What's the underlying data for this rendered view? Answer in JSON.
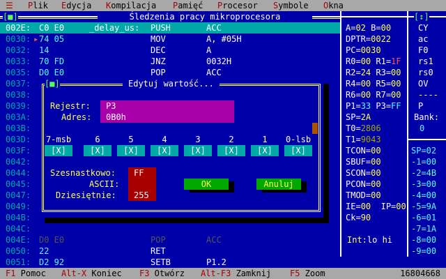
{
  "menu": {
    "system": "☰",
    "items": [
      {
        "hot": "P",
        "rest": "lik"
      },
      {
        "hot": "E",
        "rest": "dycja"
      },
      {
        "hot": "K",
        "rest": "ompilacja"
      },
      {
        "hot": "P",
        "rest": "amięć"
      },
      {
        "hot": "P",
        "rest": "rocesor"
      },
      {
        "hot": "S",
        "rest": "ymbole"
      },
      {
        "hot": "O",
        "rest": "kna"
      }
    ]
  },
  "code_window": {
    "title": "Śledzenia pracy mikroprocesora",
    "close_glyph": "[■]",
    "rows": [
      {
        "addr": "002E:",
        "bytes": "C0 E0",
        "label": "_delay_us:",
        "mnem": "PUSH",
        "oper": "ACC"
      },
      {
        "addr": "0030:",
        "bytes": "74 05",
        "label": "",
        "mnem": "MOV",
        "oper": "A, #05H"
      },
      {
        "addr": "0032:",
        "bytes": "14",
        "label": "",
        "mnem": "DEC",
        "oper": "A"
      },
      {
        "addr": "0033:",
        "bytes": "70 FD",
        "label": "",
        "mnem": "JNZ",
        "oper": "0032H"
      },
      {
        "addr": "0035:",
        "bytes": "D0 E0",
        "label": "",
        "mnem": "POP",
        "oper": "ACC"
      },
      {
        "addr": "0037:",
        "bytes": "",
        "label": "",
        "mnem": "",
        "oper": ""
      },
      {
        "addr": "0038:",
        "bytes": "",
        "label": "",
        "mnem": "",
        "oper": ""
      },
      {
        "addr": "0039:",
        "bytes": "",
        "label": "",
        "mnem": "",
        "oper": ""
      },
      {
        "addr": "003A:",
        "bytes": "",
        "label": "",
        "mnem": "",
        "oper": ""
      },
      {
        "addr": "003B:",
        "bytes": "",
        "label": "",
        "mnem": "",
        "oper": ""
      },
      {
        "addr": "003D:",
        "bytes": "",
        "label": "",
        "mnem": "",
        "oper": ""
      },
      {
        "addr": "003F:",
        "bytes": "",
        "label": "",
        "mnem": "",
        "oper": ""
      },
      {
        "addr": "0042:",
        "bytes": "",
        "label": "",
        "mnem": "",
        "oper": ""
      },
      {
        "addr": "0044:",
        "bytes": "",
        "label": "",
        "mnem": "",
        "oper": ""
      },
      {
        "addr": "0045:",
        "bytes": "",
        "label": "",
        "mnem": "",
        "oper": ""
      },
      {
        "addr": "0047:",
        "bytes": "",
        "label": "",
        "mnem": "",
        "oper": ""
      },
      {
        "addr": "0049:",
        "bytes": "",
        "label": "",
        "mnem": "",
        "oper": ""
      },
      {
        "addr": "004B:",
        "bytes": "",
        "label": "",
        "mnem": "",
        "oper": ""
      },
      {
        "addr": "004C:",
        "bytes": "",
        "label": "",
        "mnem": "",
        "oper": ""
      },
      {
        "addr": "004E:",
        "bytes": "D0 E0",
        "label": "",
        "mnem": "POP",
        "oper": "ACC"
      },
      {
        "addr": "0050:",
        "bytes": "22",
        "label": "",
        "mnem": "RET",
        "oper": ""
      },
      {
        "addr": "0051:",
        "bytes": "D2 92",
        "label": "",
        "mnem": "SETB",
        "oper": "P1.2"
      }
    ]
  },
  "registers": {
    "rows": [
      {
        "a": "A=",
        "av": "02",
        "b": " B=",
        "bv": "00"
      },
      {
        "a": "DPTR=",
        "av": "0022",
        "b": "",
        "bv": ""
      },
      {
        "a": "PC=",
        "av": "0030",
        "b": "",
        "bv": ""
      },
      {
        "a": "R0=",
        "av": "00",
        "b": " R1=",
        "bv": "1F"
      },
      {
        "a": "R2=",
        "av": "24",
        "b": " R3=",
        "bv": "00"
      },
      {
        "a": "R4=",
        "av": "00",
        "b": " R5=",
        "bv": "00"
      },
      {
        "a": "R6=",
        "av": "00",
        "b": " R7=",
        "bv": "00"
      },
      {
        "a": "P1=",
        "av": "33",
        "b": " P3=",
        "bv": "FF"
      },
      {
        "a": "SP=",
        "av": "2A",
        "b": "",
        "bv": ""
      },
      {
        "a": "T0=",
        "av": "2806",
        "b": "",
        "bv": ""
      },
      {
        "a": "T1=",
        "av": "9043",
        "b": "",
        "bv": ""
      },
      {
        "a": "TCON=",
        "av": "00",
        "b": "",
        "bv": ""
      },
      {
        "a": "SBUF=",
        "av": "00",
        "b": "",
        "bv": ""
      },
      {
        "a": "SCON=",
        "av": "00",
        "b": "",
        "bv": ""
      },
      {
        "a": "PCON=",
        "av": "00",
        "b": "",
        "bv": ""
      },
      {
        "a": "TMOD=",
        "av": "00",
        "b": "",
        "bv": ""
      },
      {
        "a": "IE=",
        "av": "00",
        "b": "  IP=",
        "bv": "00"
      },
      {
        "a": "Ck=",
        "av": "90",
        "b": "",
        "bv": ""
      }
    ],
    "int_label": "Int:",
    "int_value": "lo hi"
  },
  "flags": {
    "title_glyph": "[↕]",
    "items": [
      "CY",
      "ac",
      "F0",
      "rs1",
      "rs0",
      "OV",
      "----",
      "P"
    ],
    "bank_label": "Bank:",
    "bank_value": "0",
    "stack": [
      "SP=02",
      "-1=00",
      "-2=4B",
      "-3=00",
      "-4=00",
      "-5=9A",
      "-6=01",
      "-7=1A",
      "-8=00",
      "-9=00"
    ]
  },
  "dialog": {
    "title": "Edytuj wartość...",
    "close_glyph": "[■]",
    "register_label": "Rejestr:",
    "register_value": "P3",
    "address_label": "Adres:",
    "address_value": "0B0h",
    "bit_labels": [
      "7-msb",
      "6",
      "5",
      "4",
      "3",
      "2",
      "1",
      "0-lsb"
    ],
    "bit_values": [
      "[X]",
      "[X]",
      "[X]",
      "[X]",
      "[X]",
      "[X]",
      "[X]",
      "[X]"
    ],
    "hex_label": "Szesnastkowo:",
    "hex_value": "FF",
    "ascii_label": "ASCII:",
    "ascii_value": "",
    "dec_label": "Dziesiętnie:",
    "dec_value": "255",
    "ok_label": "OK",
    "cancel_label": "Anuluj"
  },
  "statusbar": {
    "items": [
      {
        "key": "F1",
        "label": " Pomoc"
      },
      {
        "key": "Alt-X",
        "label": " Koniec"
      },
      {
        "key": "F3",
        "label": " Otwórz"
      },
      {
        "key": "Alt-F3",
        "label": " Zamknij"
      },
      {
        "key": "F5",
        "label": " Zoom"
      }
    ],
    "memory": "16804668"
  }
}
